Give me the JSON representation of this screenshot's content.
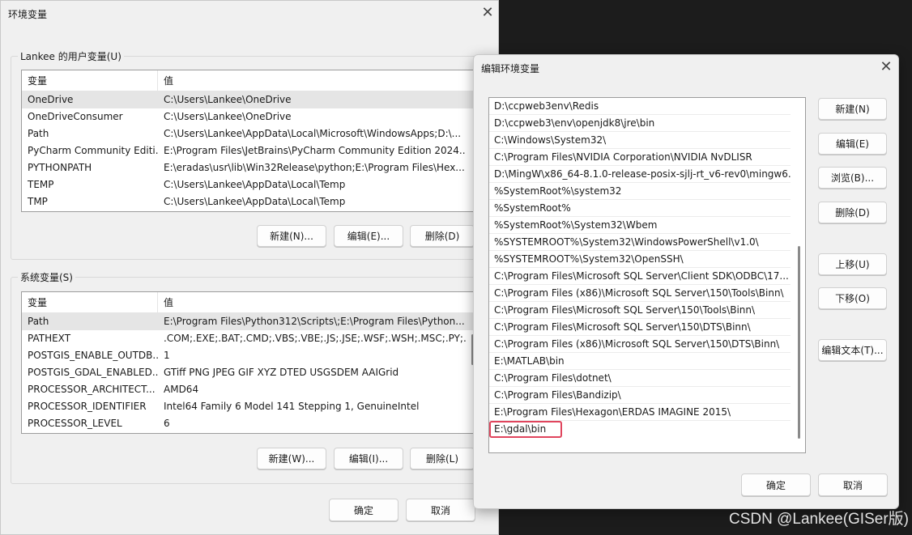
{
  "main_dialog": {
    "title": "环境变量",
    "user_group_title": "Lankee 的用户变量(U)",
    "system_group_title": "系统变量(S)",
    "col_variable": "变量",
    "col_value": "值",
    "user_vars": [
      {
        "name": "OneDrive",
        "value": "C:\\Users\\Lankee\\OneDrive"
      },
      {
        "name": "OneDriveConsumer",
        "value": "C:\\Users\\Lankee\\OneDrive"
      },
      {
        "name": "Path",
        "value": "C:\\Users\\Lankee\\AppData\\Local\\Microsoft\\WindowsApps;D:\\..."
      },
      {
        "name": "PyCharm Community Editi...",
        "value": "E:\\Program Files\\JetBrains\\PyCharm Community Edition 2024...."
      },
      {
        "name": "PYTHONPATH",
        "value": "E:\\eradas\\usr\\lib\\Win32Release\\python;E:\\Program Files\\Hex..."
      },
      {
        "name": "TEMP",
        "value": "C:\\Users\\Lankee\\AppData\\Local\\Temp"
      },
      {
        "name": "TMP",
        "value": "C:\\Users\\Lankee\\AppData\\Local\\Temp"
      }
    ],
    "user_buttons": {
      "new": "新建(N)...",
      "edit": "编辑(E)...",
      "delete": "删除(D)"
    },
    "system_vars": [
      {
        "name": "Path",
        "value": "E:\\Program Files\\Python312\\Scripts\\;E:\\Program Files\\Python..."
      },
      {
        "name": "PATHEXT",
        "value": ".COM;.EXE;.BAT;.CMD;.VBS;.VBE;.JS;.JSE;.WSF;.WSH;.MSC;.PY;.P..."
      },
      {
        "name": "POSTGIS_ENABLE_OUTDB...",
        "value": "1"
      },
      {
        "name": "POSTGIS_GDAL_ENABLED...",
        "value": "GTiff PNG JPEG GIF XYZ DTED USGSDEM AAIGrid"
      },
      {
        "name": "PROCESSOR_ARCHITECT...",
        "value": "AMD64"
      },
      {
        "name": "PROCESSOR_IDENTIFIER",
        "value": "Intel64 Family 6 Model 141 Stepping 1, GenuineIntel"
      },
      {
        "name": "PROCESSOR_LEVEL",
        "value": "6"
      }
    ],
    "system_buttons": {
      "new": "新建(W)...",
      "edit": "编辑(I)...",
      "delete": "删除(L)"
    },
    "ok": "确定",
    "cancel": "取消"
  },
  "edit_dialog": {
    "title": "编辑环境变量",
    "paths": [
      "D:\\ccpweb3env\\Redis",
      "D:\\ccpweb3\\env\\openjdk8\\jre\\bin",
      "C:\\Windows\\System32\\",
      "C:\\Program Files\\NVIDIA Corporation\\NVIDIA NvDLISR",
      "D:\\MingW\\x86_64-8.1.0-release-posix-sjlj-rt_v6-rev0\\mingw6...",
      "%SystemRoot%\\system32",
      "%SystemRoot%",
      "%SystemRoot%\\System32\\Wbem",
      "%SYSTEMROOT%\\System32\\WindowsPowerShell\\v1.0\\",
      "%SYSTEMROOT%\\System32\\OpenSSH\\",
      "C:\\Program Files\\Microsoft SQL Server\\Client SDK\\ODBC\\17...",
      "C:\\Program Files (x86)\\Microsoft SQL Server\\150\\Tools\\Binn\\",
      "C:\\Program Files\\Microsoft SQL Server\\150\\Tools\\Binn\\",
      "C:\\Program Files\\Microsoft SQL Server\\150\\DTS\\Binn\\",
      "C:\\Program Files (x86)\\Microsoft SQL Server\\150\\DTS\\Binn\\",
      "E:\\MATLAB\\bin",
      "C:\\Program Files\\dotnet\\",
      "C:\\Program Files\\Bandizip\\",
      "E:\\Program Files\\Hexagon\\ERDAS IMAGINE 2015\\",
      "E:\\gdal\\bin"
    ],
    "buttons": {
      "new": "新建(N)",
      "edit": "编辑(E)",
      "browse": "浏览(B)...",
      "delete": "删除(D)",
      "move_up": "上移(U)",
      "move_down": "下移(O)",
      "edit_text": "编辑文本(T)..."
    },
    "ok": "确定",
    "cancel": "取消"
  },
  "watermark": "CSDN @Lankee(GISer版)"
}
